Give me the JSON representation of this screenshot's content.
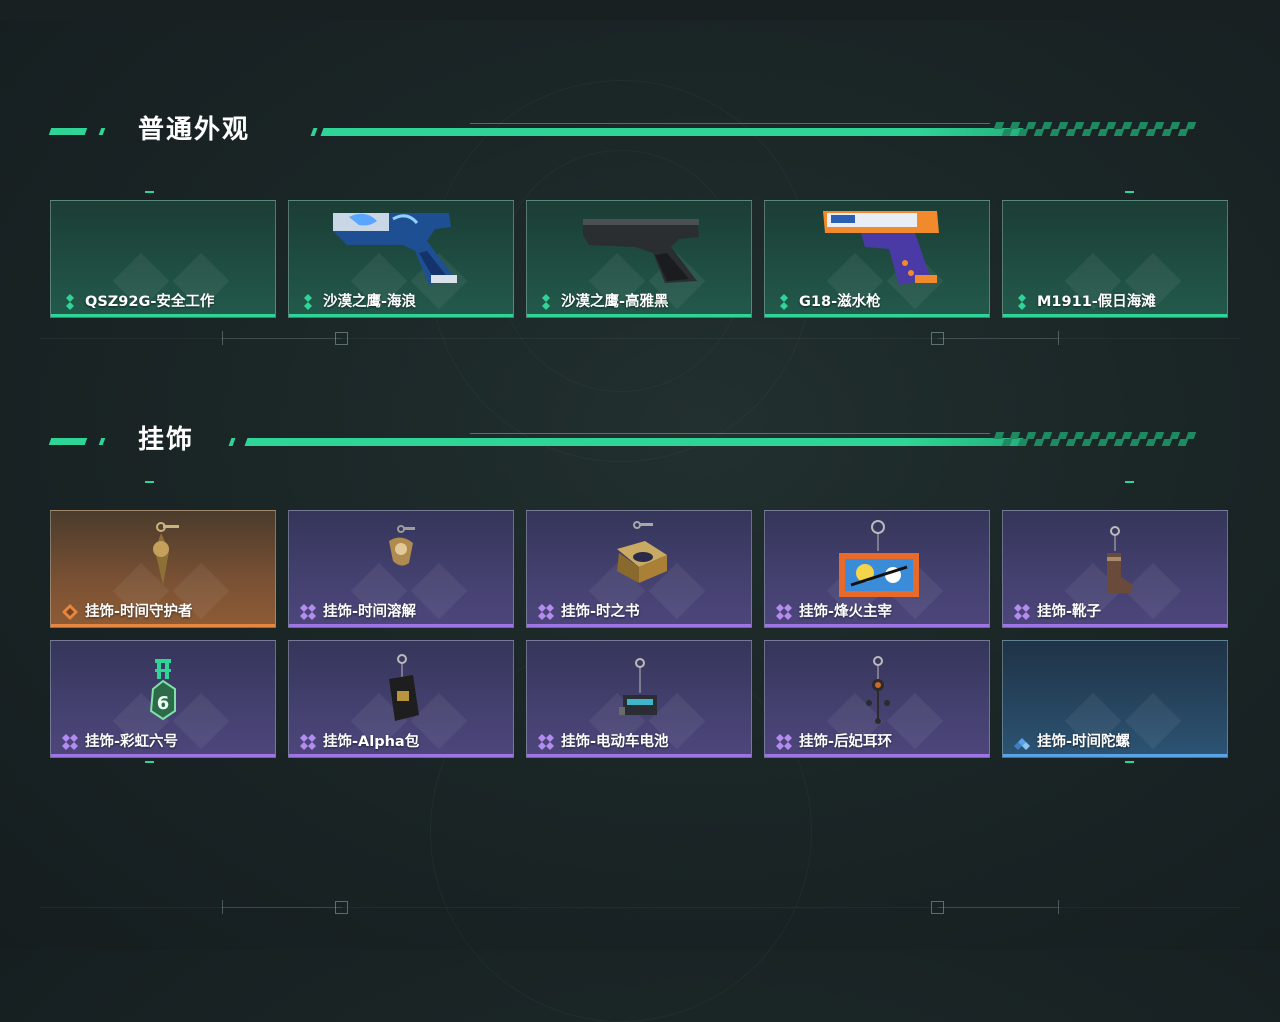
{
  "sections": [
    {
      "title": "普通外观",
      "items": [
        {
          "name": "QSZ92G-安全工作",
          "rarity": "green"
        },
        {
          "name": "沙漠之鹰-海浪",
          "rarity": "green",
          "icon": "blue-camo-pistol-icon"
        },
        {
          "name": "沙漠之鹰-高雅黑",
          "rarity": "green",
          "icon": "black-pistol-icon"
        },
        {
          "name": "G18-滋水枪",
          "rarity": "green",
          "icon": "water-gun-pistol-icon"
        },
        {
          "name": "M1911-假日海滩",
          "rarity": "green"
        }
      ]
    },
    {
      "title": "挂饰",
      "items": [
        {
          "name": "挂饰-时间守护者",
          "rarity": "orange",
          "icon": "golden-charm-icon"
        },
        {
          "name": "挂饰-时间溶解",
          "rarity": "purple",
          "icon": "melting-clock-charm-icon"
        },
        {
          "name": "挂饰-时之书",
          "rarity": "purple",
          "icon": "book-charm-icon"
        },
        {
          "name": "挂饰-烽火主宰",
          "rarity": "purple",
          "icon": "sticker-box-charm-icon"
        },
        {
          "name": "挂饰-靴子",
          "rarity": "purple",
          "icon": "boot-charm-icon"
        },
        {
          "name": "挂饰-彩虹六号",
          "rarity": "purple",
          "icon": "rainbow-six-charm-icon"
        },
        {
          "name": "挂饰-Alpha包",
          "rarity": "purple",
          "icon": "alpha-pack-charm-icon"
        },
        {
          "name": "挂饰-电动车电池",
          "rarity": "purple",
          "icon": "battery-charm-icon"
        },
        {
          "name": "挂饰-后妃耳环",
          "rarity": "purple",
          "icon": "earring-charm-icon"
        },
        {
          "name": "挂饰-时间陀螺",
          "rarity": "blue"
        }
      ]
    }
  ],
  "colors": {
    "accent": "#2fd596",
    "rarity_green": "#2fd596",
    "rarity_orange": "#e78640",
    "rarity_purple": "#9f74e4",
    "rarity_blue": "#5ba3e6"
  }
}
